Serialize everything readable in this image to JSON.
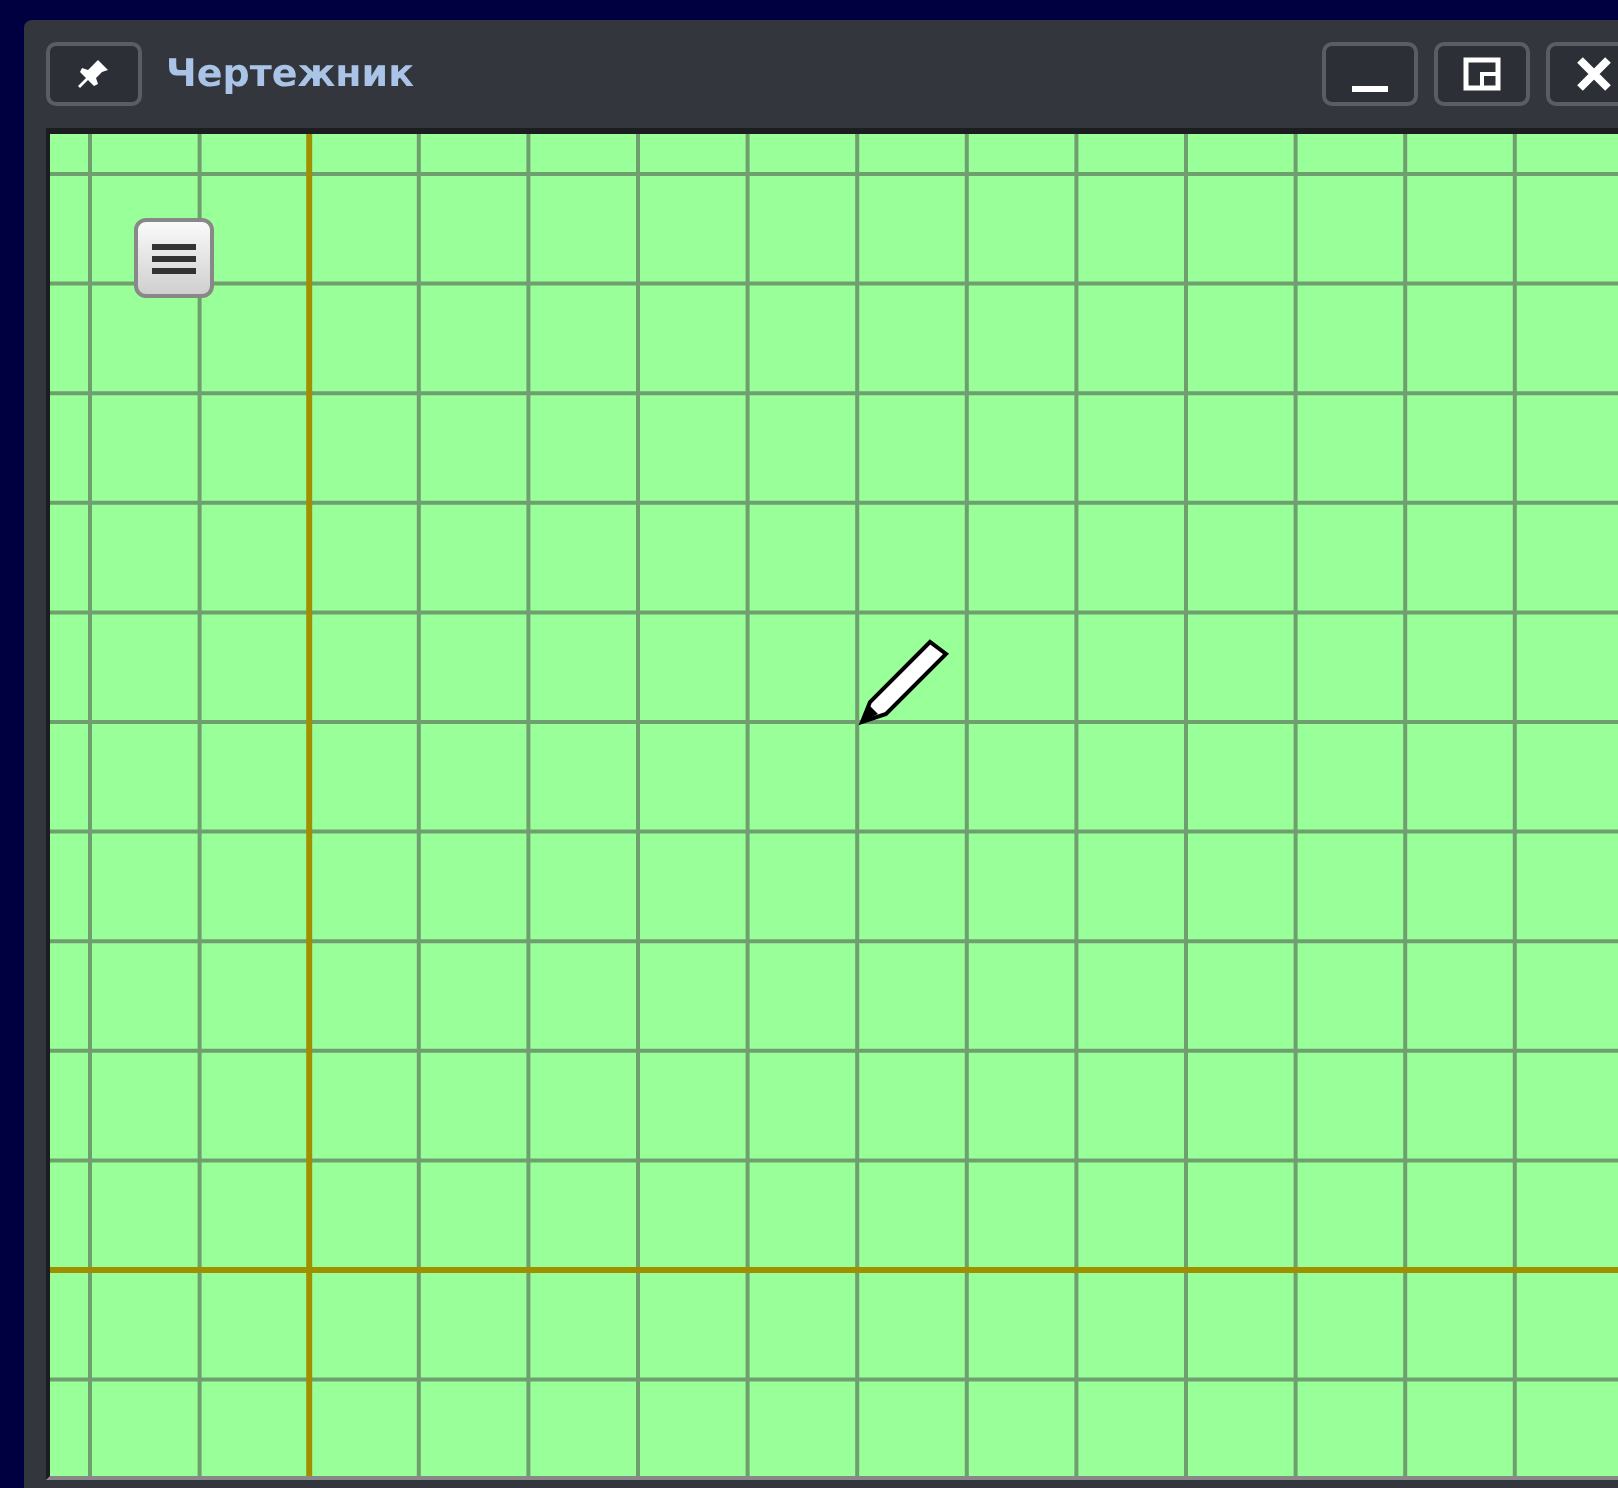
{
  "window": {
    "title": "Чертежник"
  }
}
